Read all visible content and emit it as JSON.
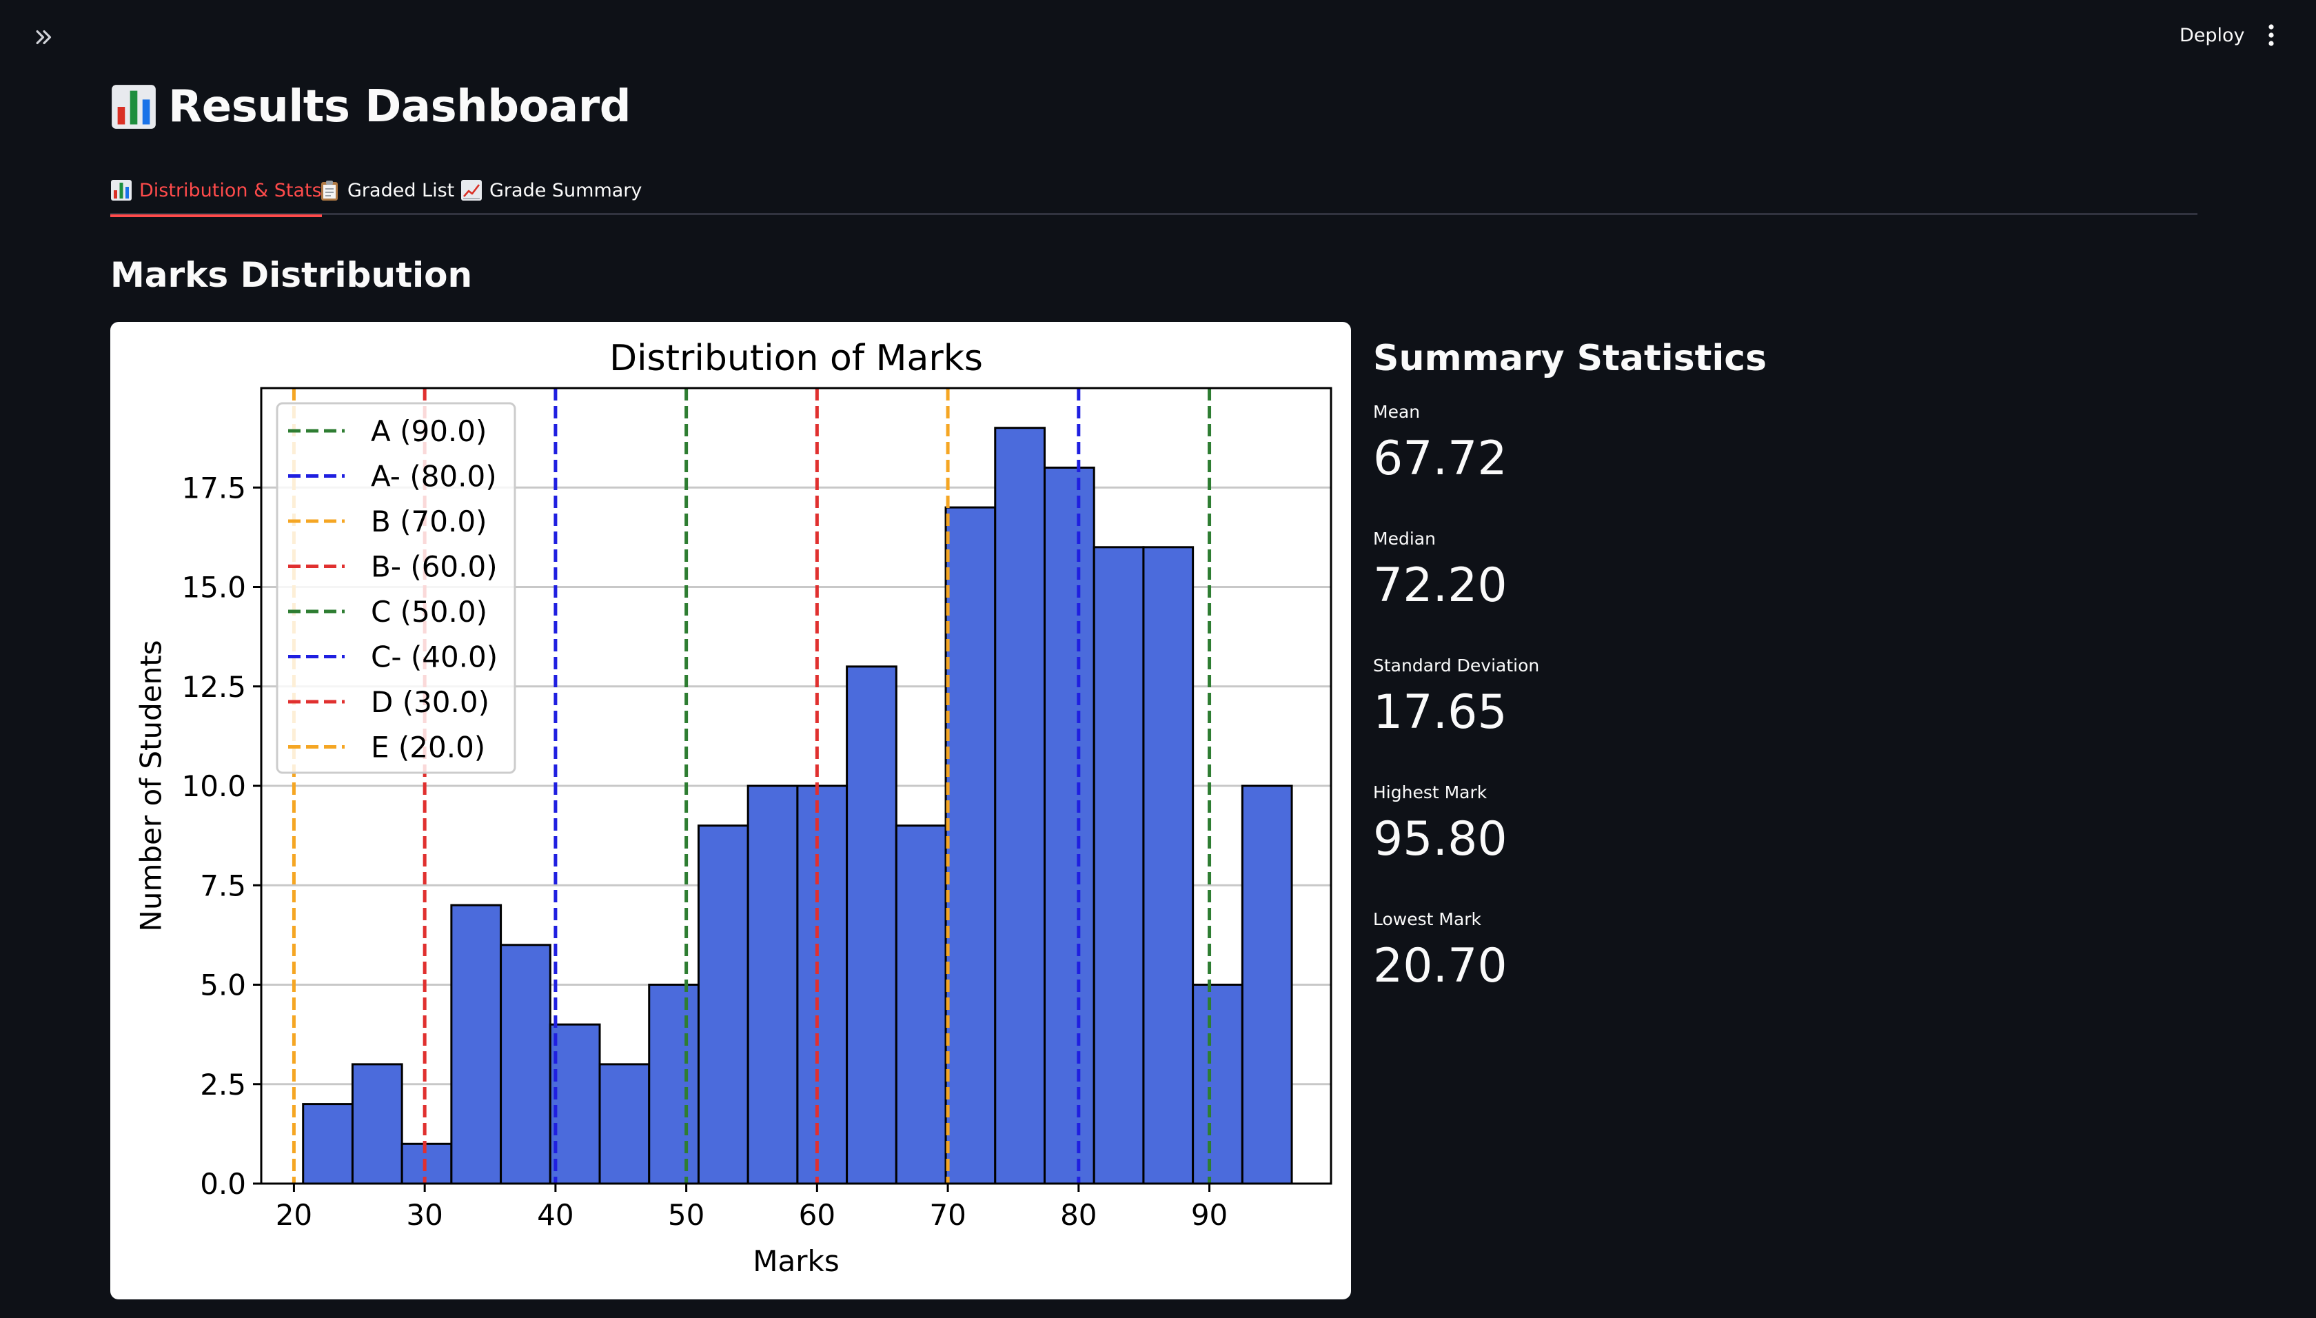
{
  "header": {
    "deploy_label": "Deploy"
  },
  "page": {
    "title": "Results Dashboard",
    "title_icon": "bar-chart-icon"
  },
  "tabs": [
    {
      "label": "Distribution & Stats",
      "icon": "bar-chart-icon",
      "active": true
    },
    {
      "label": "Graded List",
      "icon": "clipboard-icon",
      "active": false
    },
    {
      "label": "Grade Summary",
      "icon": "chart-increasing-icon",
      "active": false
    }
  ],
  "section": {
    "heading": "Marks Distribution"
  },
  "stats": {
    "heading": "Summary Statistics",
    "metrics": [
      {
        "label": "Mean",
        "value": "67.72"
      },
      {
        "label": "Median",
        "value": "72.20"
      },
      {
        "label": "Standard Deviation",
        "value": "17.65"
      },
      {
        "label": "Highest Mark",
        "value": "95.80"
      },
      {
        "label": "Lowest Mark",
        "value": "20.70"
      }
    ]
  },
  "colors": {
    "accent": "#ff4b4b",
    "background": "#0e1117",
    "bar_fill": "#4b6bdc",
    "grade_green": "#2e7d32",
    "grade_blue": "#1f1fe0",
    "grade_orange": "#f5a623",
    "grade_red": "#e0302f"
  },
  "chart_data": {
    "type": "bar",
    "title": "Distribution of Marks",
    "xlabel": "Marks",
    "ylabel": "Number of Students",
    "bin_edges": [
      20.7,
      24.48,
      28.26,
      32.04,
      35.82,
      39.6,
      43.38,
      47.16,
      50.94,
      54.72,
      58.5,
      62.28,
      66.06,
      69.84,
      73.62,
      77.4,
      81.18,
      84.96,
      88.74,
      92.52,
      96.3
    ],
    "values": [
      2,
      3,
      1,
      7,
      6,
      4,
      3,
      5,
      9,
      10,
      10,
      13,
      9,
      17,
      19,
      18,
      16,
      16,
      5,
      10
    ],
    "xlim": [
      17.5,
      99.3
    ],
    "ylim": [
      0,
      20
    ],
    "xticks": [
      20,
      30,
      40,
      50,
      60,
      70,
      80,
      90
    ],
    "yticks": [
      0.0,
      2.5,
      5.0,
      7.5,
      10.0,
      12.5,
      15.0,
      17.5
    ],
    "grid": "y",
    "legend_position": "top-left",
    "thresholds": [
      {
        "label": "A (90.0)",
        "x": 90,
        "color": "#2e7d32"
      },
      {
        "label": "A- (80.0)",
        "x": 80,
        "color": "#1f1fe0"
      },
      {
        "label": "B (70.0)",
        "x": 70,
        "color": "#f5a623"
      },
      {
        "label": "B- (60.0)",
        "x": 60,
        "color": "#e0302f"
      },
      {
        "label": "C (50.0)",
        "x": 50,
        "color": "#2e7d32"
      },
      {
        "label": "C- (40.0)",
        "x": 40,
        "color": "#1f1fe0"
      },
      {
        "label": "D (30.0)",
        "x": 30,
        "color": "#e0302f"
      },
      {
        "label": "E (20.0)",
        "x": 20,
        "color": "#f5a623"
      }
    ]
  }
}
